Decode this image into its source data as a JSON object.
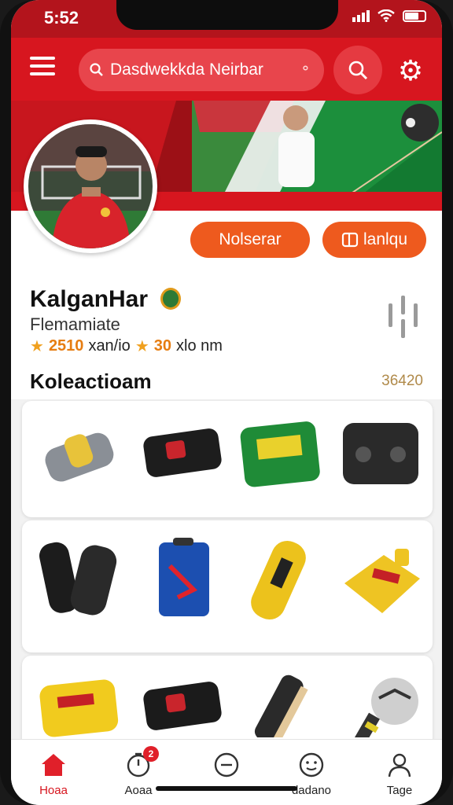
{
  "status_bar": {
    "time": "5:52"
  },
  "header": {
    "search_text": "Dasdwekkda Neirbar"
  },
  "profile": {
    "follow_label": "Nolserar",
    "message_label": "lanlqu",
    "name": "KalganHar",
    "role": "Flemamiate",
    "stat1_value": "2510",
    "stat1_label": "xan/io",
    "stat2_value": "30",
    "stat2_label": "xlo nm"
  },
  "collection": {
    "title": "Koleactioam",
    "count": "36420",
    "items": [
      {
        "name": "scarf-roll-icon",
        "color": "#8a8f96"
      },
      {
        "name": "black-pencil-case-icon",
        "color": "#1d1d1d"
      },
      {
        "name": "green-case-icon",
        "color": "#1f8b37"
      },
      {
        "name": "black-camera-bag-icon",
        "color": "#2a2a2a"
      },
      {
        "name": "gloves-icon",
        "color": "#1c1c1c"
      },
      {
        "name": "blue-backpack-icon",
        "color": "#1c4fb0"
      },
      {
        "name": "yellow-phone-case-icon",
        "color": "#ecc21c"
      },
      {
        "name": "yellow-card-holder-icon",
        "color": "#eec423"
      },
      {
        "name": "yellow-suitcase-icon",
        "color": "#f1cb1e"
      },
      {
        "name": "black-badge-case-icon",
        "color": "#1b1b1b"
      },
      {
        "name": "shin-guard-icon",
        "color": "#2a2a2a"
      },
      {
        "name": "ball-keychain-icon",
        "color": "#cfcfcf"
      }
    ]
  },
  "tabs": [
    {
      "label": "Hoaa",
      "icon": "home-icon"
    },
    {
      "label": "Aoaa",
      "icon": "timer-icon",
      "badge": "2"
    },
    {
      "label": "",
      "icon": "minus-circle-icon"
    },
    {
      "label": "dadano",
      "icon": "face-icon"
    },
    {
      "label": "Tage",
      "icon": "person-icon"
    }
  ],
  "colors": {
    "brand_red": "#d7161f",
    "accent_orange": "#ee5a1e"
  }
}
